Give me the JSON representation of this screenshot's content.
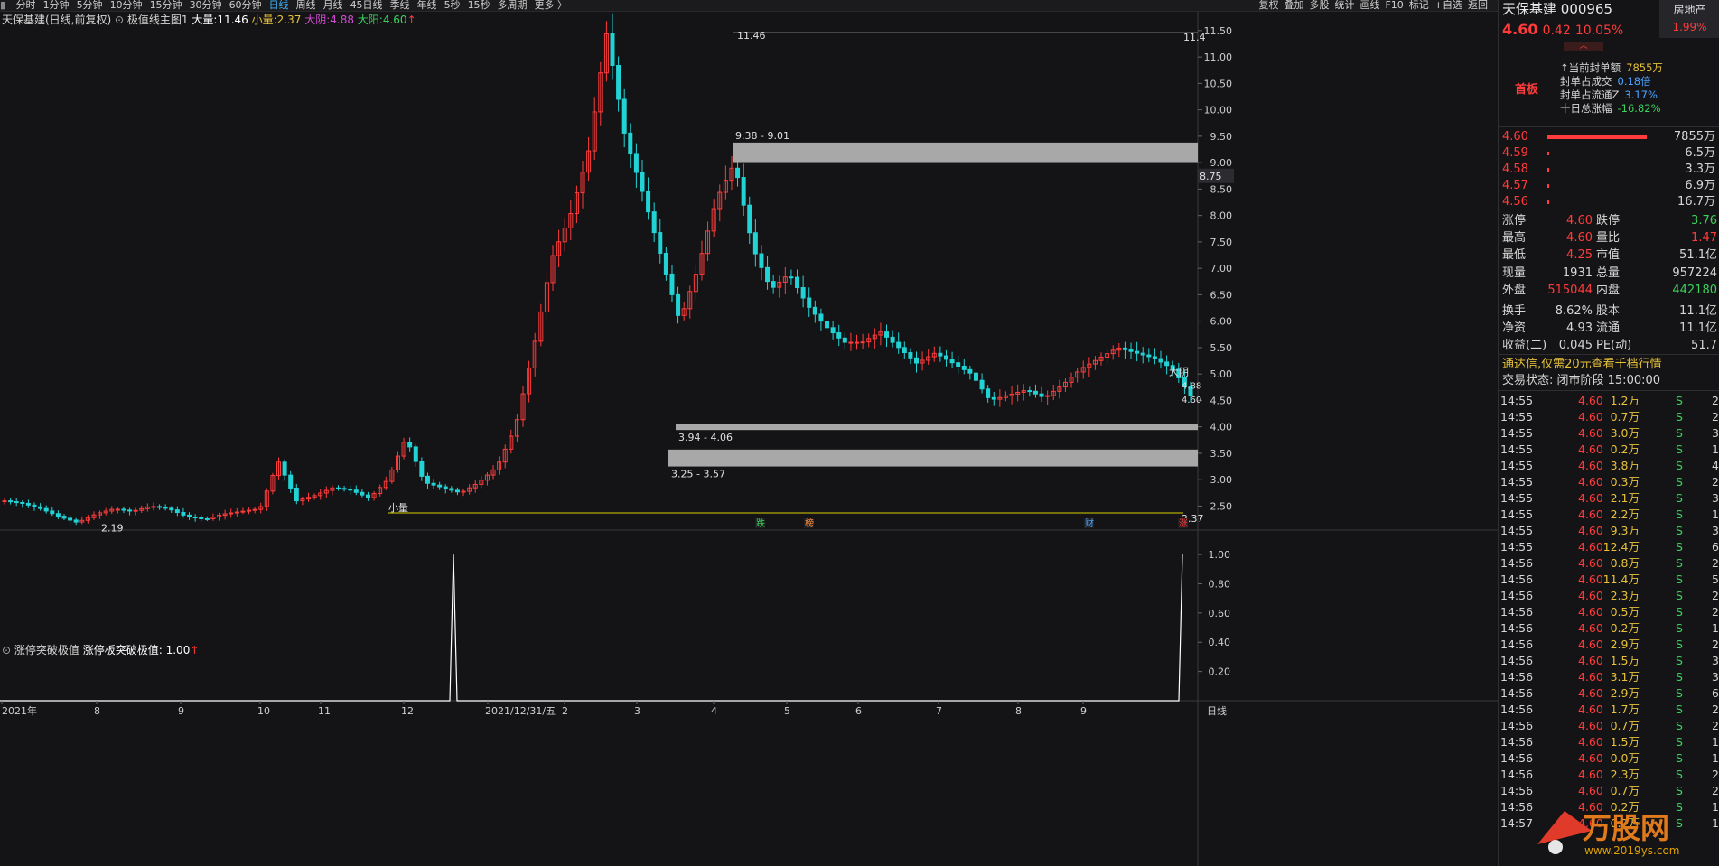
{
  "toolbar": {
    "periods": [
      "分时",
      "1分钟",
      "5分钟",
      "10分钟",
      "15分钟",
      "30分钟",
      "60分钟",
      "日线",
      "周线",
      "月线",
      "45日线",
      "季线",
      "年线",
      "5秒",
      "15秒",
      "多周期",
      "更多 〉"
    ],
    "active_period": "日线",
    "right_items": [
      "复权",
      "叠加",
      "多股",
      "统计",
      "画线",
      "F10",
      "标记",
      "+自选",
      "返回"
    ]
  },
  "legend_main": {
    "title": "天保基建(日线,前复权)",
    "indicator": "极值线主图1",
    "big_label": "大量:",
    "big_value": "11.46",
    "small_label": "小量:",
    "small_value": "2.37",
    "yin_label": "大阴:",
    "yin_value": "4.88",
    "yang_label": "大阳:",
    "yang_value": "4.60",
    "arrow": "↑"
  },
  "legend_sub": {
    "title": "涨停突破极值",
    "indicator_label": "涨停板突破极值:",
    "indicator_value": "1.00",
    "arrow": "↑"
  },
  "colors": {
    "up": "#ff3b3b",
    "down": "#22d3d6",
    "band": "#a8a8a8",
    "small_line": "#d8d000",
    "accent": "#3db6ff"
  },
  "chart_data": [
    {
      "type": "candlestick",
      "title": "天保基建(日线,前复权)",
      "ylim": [
        2.2,
        11.6
      ],
      "y_ticks": [
        "11.50",
        "11.00",
        "10.50",
        "10.00",
        "9.50",
        "9.00",
        "8.50",
        "8.00",
        "7.50",
        "7.00",
        "6.50",
        "6.00",
        "5.50",
        "5.00",
        "4.50",
        "4.00",
        "3.50",
        "3.00",
        "2.50"
      ],
      "x_labels": [
        "2021年",
        "8",
        "9",
        "10",
        "11",
        "12",
        "2021/12/31/五",
        "2",
        "3",
        "4",
        "5",
        "6",
        "7",
        "8",
        "9"
      ],
      "bands": [
        {
          "label": "9.38 - 9.01",
          "low": 9.01,
          "high": 9.38
        },
        {
          "label": "3.94 - 4.06",
          "low": 3.94,
          "high": 4.06
        },
        {
          "label": "3.25 - 3.57",
          "low": 3.25,
          "high": 3.57
        }
      ],
      "annotations": {
        "high_label": "11.46",
        "high_value": 11.46,
        "low_label": "2.19",
        "low_value": 2.19,
        "small_label": "小量",
        "small_value": 2.37,
        "small_right": "2.37",
        "right_high": "11.4",
        "big_yin": "大阴",
        "big_yin_value": "4.88",
        "big_yang": "大阳",
        "big_yang_value": "4.60",
        "cursor_price": "8.75"
      },
      "event_markers": [
        "跌",
        "榜",
        "财",
        "涨"
      ],
      "close_series_anchor": [
        2.6,
        2.55,
        2.45,
        2.3,
        2.19,
        2.35,
        2.45,
        2.4,
        2.5,
        2.45,
        2.3,
        2.25,
        2.35,
        2.4,
        2.45,
        3.35,
        2.6,
        2.7,
        2.85,
        2.8,
        2.65,
        3.0,
        3.8,
        2.95,
        2.85,
        2.75,
        2.95,
        3.25,
        4.0,
        5.5,
        7.2,
        8.0,
        9.2,
        11.46,
        9.5,
        8.4,
        7.2,
        6.0,
        7.0,
        8.3,
        9.0,
        7.4,
        6.6,
        6.9,
        6.3,
        5.9,
        5.6,
        5.6,
        5.8,
        5.5,
        5.2,
        5.4,
        5.2,
        5.0,
        4.5,
        4.6,
        4.7,
        4.55,
        4.8,
        5.1,
        5.3,
        5.5,
        5.4,
        5.3,
        5.1,
        4.6
      ]
    },
    {
      "type": "line",
      "title": "涨停突破极值",
      "ylim": [
        0,
        1.05
      ],
      "y_ticks": [
        "1.00",
        "0.80",
        "0.60",
        "0.40",
        "0.20"
      ],
      "spikes": [
        {
          "x_index": 14,
          "value": 1.0
        },
        {
          "x_index": 65,
          "value": 1.0
        }
      ],
      "x_right_label": "日线"
    }
  ],
  "panel": {
    "stock_name": "天保基建",
    "stock_code": "000965",
    "sector": "房地产",
    "sector_change": "1.99%",
    "price": "4.60",
    "change": "0.42",
    "change_pct": "10.05%",
    "board_badge": "首板",
    "seal": [
      {
        "label": "↑当前封单额",
        "value": "7855万"
      },
      {
        "label": "封单占成交",
        "value": "0.18倍"
      },
      {
        "label": "封单占流通Z",
        "value": "3.17%"
      },
      {
        "label": "十日总涨幅",
        "value": "-16.82%"
      }
    ],
    "bids": [
      {
        "price": "4.60",
        "vol": "7855万"
      },
      {
        "price": "4.59",
        "vol": "6.5万"
      },
      {
        "price": "4.58",
        "vol": "3.3万"
      },
      {
        "price": "4.57",
        "vol": "6.9万"
      },
      {
        "price": "4.56",
        "vol": "16.7万"
      }
    ],
    "stats": [
      [
        "涨停",
        "4.60",
        "跌停",
        "3.76"
      ],
      [
        "最高",
        "4.60",
        "量比",
        "1.47"
      ],
      [
        "最低",
        "4.25",
        "市值",
        "51.1亿"
      ],
      [
        "现量",
        "1931",
        "总量",
        "957224"
      ],
      [
        "外盘",
        "515044",
        "内盘",
        "442180"
      ],
      [
        "换手",
        "8.62%",
        "股本",
        "11.1亿"
      ],
      [
        "净资",
        "4.93",
        "流通",
        "11.1亿"
      ],
      [
        "收益(二)",
        "0.045",
        "PE(动)",
        "51.7"
      ]
    ],
    "promo": "通达信,仅需20元查看千档行情",
    "trade_state": "交易状态: 闭市阶段 15:00:00",
    "ticks": [
      [
        "14:55",
        "4.60",
        "1.2万",
        "S",
        "2"
      ],
      [
        "14:55",
        "4.60",
        "0.7万",
        "S",
        "2"
      ],
      [
        "14:55",
        "4.60",
        "3.0万",
        "S",
        "3"
      ],
      [
        "14:55",
        "4.60",
        "0.2万",
        "S",
        "1"
      ],
      [
        "14:55",
        "4.60",
        "3.8万",
        "S",
        "4"
      ],
      [
        "14:55",
        "4.60",
        "0.3万",
        "S",
        "2"
      ],
      [
        "14:55",
        "4.60",
        "2.1万",
        "S",
        "3"
      ],
      [
        "14:55",
        "4.60",
        "2.2万",
        "S",
        "1"
      ],
      [
        "14:55",
        "4.60",
        "9.3万",
        "S",
        "3"
      ],
      [
        "14:55",
        "4.60",
        "12.4万",
        "S",
        "6"
      ],
      [
        "14:56",
        "4.60",
        "0.8万",
        "S",
        "2"
      ],
      [
        "14:56",
        "4.60",
        "11.4万",
        "S",
        "5"
      ],
      [
        "14:56",
        "4.60",
        "2.3万",
        "S",
        "2"
      ],
      [
        "14:56",
        "4.60",
        "0.5万",
        "S",
        "2"
      ],
      [
        "14:56",
        "4.60",
        "0.2万",
        "S",
        "1"
      ],
      [
        "14:56",
        "4.60",
        "2.9万",
        "S",
        "2"
      ],
      [
        "14:56",
        "4.60",
        "1.5万",
        "S",
        "3"
      ],
      [
        "14:56",
        "4.60",
        "3.1万",
        "S",
        "3"
      ],
      [
        "14:56",
        "4.60",
        "2.9万",
        "S",
        "6"
      ],
      [
        "14:56",
        "4.60",
        "1.7万",
        "S",
        "2"
      ],
      [
        "14:56",
        "4.60",
        "0.7万",
        "S",
        "2"
      ],
      [
        "14:56",
        "4.60",
        "1.5万",
        "S",
        "1"
      ],
      [
        "14:56",
        "4.60",
        "0.0万",
        "S",
        "1"
      ],
      [
        "14:56",
        "4.60",
        "2.3万",
        "S",
        "2"
      ],
      [
        "14:56",
        "4.60",
        "0.7万",
        "S",
        "2"
      ],
      [
        "14:56",
        "4.60",
        "0.2万",
        "S",
        "1"
      ],
      [
        "14:57",
        "4.60",
        "0.2万",
        "S",
        "1"
      ]
    ],
    "watermark": "万股网",
    "watermark_url": "www.2019ys.com"
  }
}
